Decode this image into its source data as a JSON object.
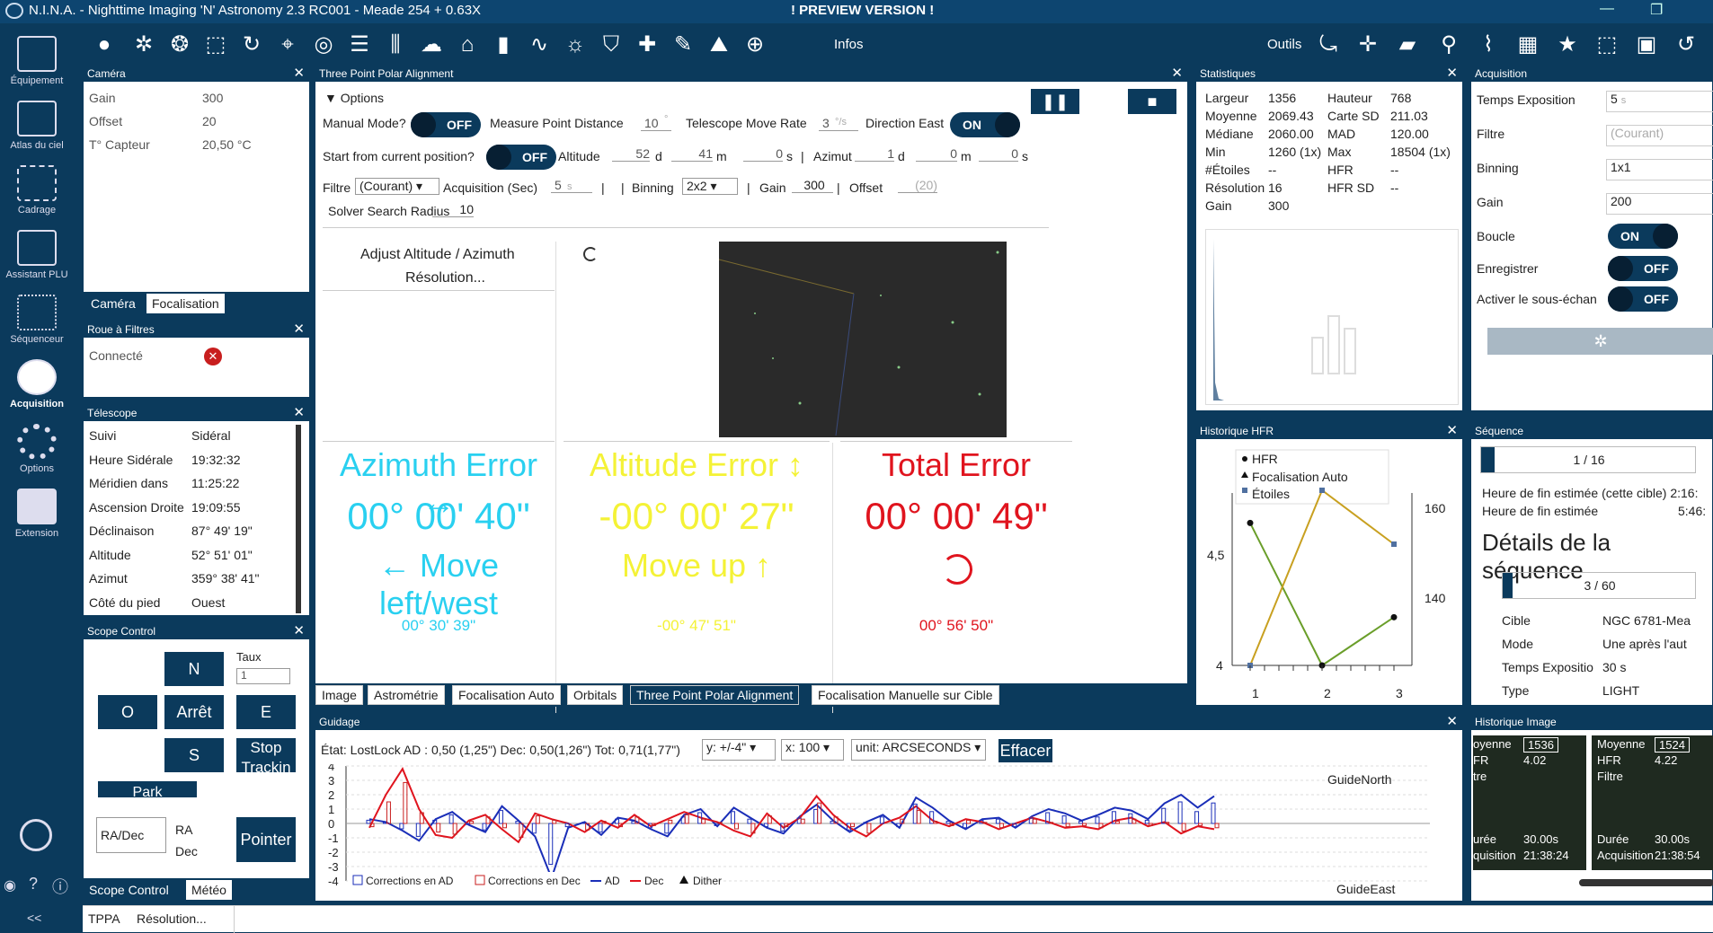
{
  "app": {
    "title": "N.I.N.A. - Nighttime Imaging 'N' Astronomy 2.3 RC001  -  Meade 254 + 0.63X",
    "preview": "! PREVIEW VERSION !"
  },
  "nav": [
    {
      "label": "Équipement"
    },
    {
      "label": "Atlas du ciel"
    },
    {
      "label": "Cadrage"
    },
    {
      "label": "Assistant PLU"
    },
    {
      "label": "Séquenceur"
    },
    {
      "label": "Acquisition"
    },
    {
      "label": "Options"
    },
    {
      "label": "Extension"
    }
  ],
  "nav_bottom": "<<",
  "toolbar": {
    "infos": "Infos",
    "outils": "Outils"
  },
  "camera": {
    "title": "Caméra",
    "rows": [
      {
        "k": "Gain",
        "v": "300"
      },
      {
        "k": "Offset",
        "v": "20"
      },
      {
        "k": "T° Capteur",
        "v": "20,50 °C"
      }
    ],
    "tabs": [
      "Caméra",
      "Focalisation"
    ]
  },
  "filterwheel": {
    "title": "Roue à Filtres",
    "connected": "Connecté"
  },
  "telescope": {
    "title": "Télescope",
    "rows": [
      {
        "k": "Suivi",
        "v": "Sidéral"
      },
      {
        "k": "Heure Sidérale",
        "v": "19:32:32"
      },
      {
        "k": "Méridien dans",
        "v": "11:25:22"
      },
      {
        "k": "Ascension Droite",
        "v": "19:09:55"
      },
      {
        "k": "Déclinaison",
        "v": "87° 49' 19\""
      },
      {
        "k": "Altitude",
        "v": "52° 51' 01\""
      },
      {
        "k": "Azimut",
        "v": "359° 38' 41\""
      },
      {
        "k": "Côté du pied",
        "v": "Ouest"
      }
    ]
  },
  "scope": {
    "title": "Scope Control",
    "n": "N",
    "o": "O",
    "stop": "Arrêt",
    "e": "E",
    "s": "S",
    "stoptrack": "Stop Trackin",
    "park": "Park",
    "taux": "Taux",
    "taux_val": "1",
    "coord": "RA/Dec",
    "ra": "RA",
    "dec": "Dec",
    "point": "Pointer",
    "tabs": [
      "Scope Control",
      "Météo"
    ]
  },
  "tppa": {
    "title": "Three Point Polar Alignment",
    "options": "Options",
    "manual": "Manual Mode?",
    "off": "OFF",
    "on": "ON",
    "measure": "Measure Point Distance",
    "measure_val": "10",
    "measure_unit": "°",
    "move": "Telescope Move Rate",
    "move_val": "3",
    "move_unit": "°/s",
    "dir": "Direction East",
    "start": "Start from current position?",
    "alt": "Altitude",
    "alt_d": "52",
    "alt_m": "41",
    "alt_s": "0",
    "az": "Azimut",
    "az_d": "1",
    "az_m": "0",
    "az_s": "0",
    "d": "d",
    "m": "m",
    "s": "s",
    "pipe": "|",
    "filtre": "Filtre",
    "filtre_val": "(Courant)",
    "acq": "Acquisition (Sec)",
    "acq_val": "5",
    "acq_unit": "s",
    "binning": "Binning",
    "bin_val": "2x2",
    "gain": "Gain",
    "gain_val": "300",
    "offset": "Offset",
    "offset_val": "(20)",
    "radius": "Solver Search Radius",
    "radius_val": "10",
    "adjust": "Adjust Altitude / Azimuth",
    "resolution": "Résolution...",
    "az_err": {
      "title": "Azimuth Error ↔",
      "val": "00° 00' 40\"",
      "move": "← Move left/west",
      "sub": "00° 30' 39\""
    },
    "alt_err": {
      "title": "Altitude Error ↕",
      "val": "-00° 00' 27\"",
      "move": "Move up ↑",
      "sub": "-00° 47' 51\""
    },
    "tot_err": {
      "title": "Total Error",
      "val": "00° 00' 49\"",
      "sub": "00° 56' 50\""
    },
    "tabs": [
      "Image",
      "Astrométrie",
      "Focalisation Auto",
      "Orbitals",
      "Three Point Polar Alignment",
      "Focalisation Manuelle sur Cible"
    ]
  },
  "stats": {
    "title": "Statistiques",
    "left": [
      {
        "k": "Largeur",
        "v": "1356"
      },
      {
        "k": "Moyenne",
        "v": "2069.43"
      },
      {
        "k": "Médiane",
        "v": "2060.00"
      },
      {
        "k": "Min",
        "v": "1260 (1x)"
      },
      {
        "k": "#Étoiles",
        "v": "--"
      },
      {
        "k": "Résolution",
        "v": "16"
      },
      {
        "k": "Gain",
        "v": "300"
      }
    ],
    "right": [
      {
        "k": "Hauteur",
        "v": "768"
      },
      {
        "k": "Carte SD",
        "v": "211.03"
      },
      {
        "k": "MAD",
        "v": "120.00"
      },
      {
        "k": "Max",
        "v": "18504 (1x)"
      },
      {
        "k": "HFR",
        "v": "--"
      },
      {
        "k": "HFR SD",
        "v": "--"
      }
    ]
  },
  "hfr": {
    "title": "Historique HFR",
    "legend": [
      "HFR",
      "Focalisation Auto",
      "Étoiles"
    ],
    "yl": [
      "4,5",
      "4"
    ],
    "yr": [
      "160",
      "140"
    ],
    "x": [
      "1",
      "2",
      "3"
    ]
  },
  "acquisition": {
    "title": "Acquisition",
    "rows": [
      {
        "k": "Temps Exposition",
        "v": "5",
        "u": "s"
      },
      {
        "k": "Filtre",
        "v": "(Courant)"
      },
      {
        "k": "Binning",
        "v": "1x1"
      },
      {
        "k": "Gain",
        "v": "200"
      }
    ],
    "boucle": "Boucle",
    "enreg": "Enregistrer",
    "sous": "Activer le sous-échan",
    "on": "ON",
    "off": "OFF"
  },
  "sequence": {
    "title": "Séquence",
    "prog1": "1 / 16",
    "end_target": "Heure de fin estimée (cette cible)",
    "end_target_v": "2:16:",
    "end": "Heure de fin estimée",
    "end_v": "5:46:",
    "details": "Détails de la séquence",
    "prog2": "3 / 60",
    "rows": [
      {
        "k": "Cible",
        "v": "NGC 6781-Mea"
      },
      {
        "k": "Mode",
        "v": "Une après l'aut"
      },
      {
        "k": "Temps Expositio",
        "v": "30 s"
      },
      {
        "k": "Type",
        "v": "LIGHT"
      }
    ]
  },
  "guiding": {
    "title": "Guidage",
    "state": "État: LostLock  AD : 0,50 (1,25\")  Dec: 0,50(1,26\")  Tot: 0,71(1,77\")",
    "y": "y: +/-4\"",
    "x": "x: 100",
    "unit": "unit: ARCSECONDS",
    "clear": "Effacer",
    "north": "GuideNorth",
    "east": "GuideEast",
    "legend": [
      "Corrections en AD",
      "Corrections en Dec",
      "AD",
      "Dec",
      "Dither"
    ],
    "yticks": [
      "4",
      "3",
      "2",
      "1",
      "0",
      "-1",
      "-2",
      "-3",
      "-4"
    ]
  },
  "history": {
    "title": "Historique Image",
    "a": {
      "r1k": "oyenne",
      "r1v": "1536",
      "r2k": "FR",
      "r2v": "4.02",
      "r3k": "tre",
      "r4k": "urée",
      "r4v": "30.00s",
      "r5k": "quisition",
      "r5v": "21:38:24"
    },
    "b": {
      "r1k": "Moyenne",
      "r1v": "1524",
      "r2k": "HFR",
      "r2v": "4.22",
      "r3k": "Filtre",
      "r4k": "Durée",
      "r4v": "30.00s",
      "r5k": "Acquisition",
      "r5v": "21:38:54"
    }
  },
  "status": {
    "tppa": "TPPA",
    "msg": "Résolution..."
  },
  "chart_data": {
    "type": "line",
    "x": [
      1,
      2,
      3
    ],
    "series": [
      {
        "name": "HFR",
        "values": [
          4.65,
          4.0,
          4.22
        ]
      },
      {
        "name": "Étoiles",
        "values": [
          126,
          165,
          153
        ]
      }
    ]
  }
}
